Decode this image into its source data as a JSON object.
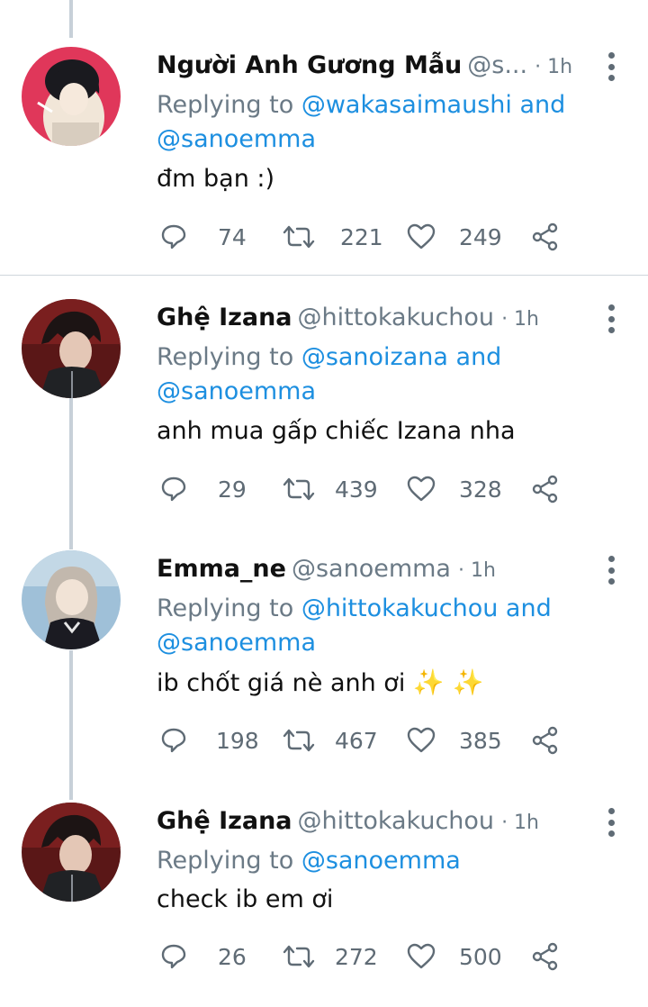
{
  "tweets": [
    {
      "name": "Người Anh Gương Mẫu",
      "handle": "@s...",
      "time": "· 1h",
      "replying_prefix": "Replying to ",
      "replying_mention1": "@wakasaimaushi",
      "replying_and": " and",
      "replying_mention2": "@sanoemma",
      "text": "đm bạn :)",
      "replies": "74",
      "retweets": "221",
      "likes": "249"
    },
    {
      "name": "Ghệ Izana",
      "handle": "@hittokakuchou",
      "time": "· 1h",
      "replying_prefix": "Replying to ",
      "replying_mention1": "@sanoizana",
      "replying_and": " and",
      "replying_mention2": "@sanoemma",
      "text": "anh mua gấp chiếc Izana nha",
      "replies": "29",
      "retweets": "439",
      "likes": "328"
    },
    {
      "name": "Emma_ne",
      "handle": "@sanoemma",
      "time": "· 1h",
      "replying_prefix": "Replying to ",
      "replying_mention1": "@hittokakuchou",
      "replying_and": " and",
      "replying_mention2": "@sanoemma",
      "text": "ib chốt giá nè anh ơi",
      "text_emoji": "✨ ✨",
      "replies": "198",
      "retweets": "467",
      "likes": "385"
    },
    {
      "name": "Ghệ Izana",
      "handle": "@hittokakuchou",
      "time": "· 1h",
      "replying_prefix": "Replying to ",
      "replying_mention1": "@sanoemma",
      "text": "check ib em ơi",
      "replies": "26",
      "retweets": "272",
      "likes": "500"
    }
  ],
  "colors": {
    "mention": "#1d8fe0",
    "muted": "#6b7a86",
    "thread_line": "#c7d0d8"
  },
  "icons": [
    "reply-icon",
    "retweet-icon",
    "like-icon",
    "share-icon",
    "more-icon"
  ]
}
